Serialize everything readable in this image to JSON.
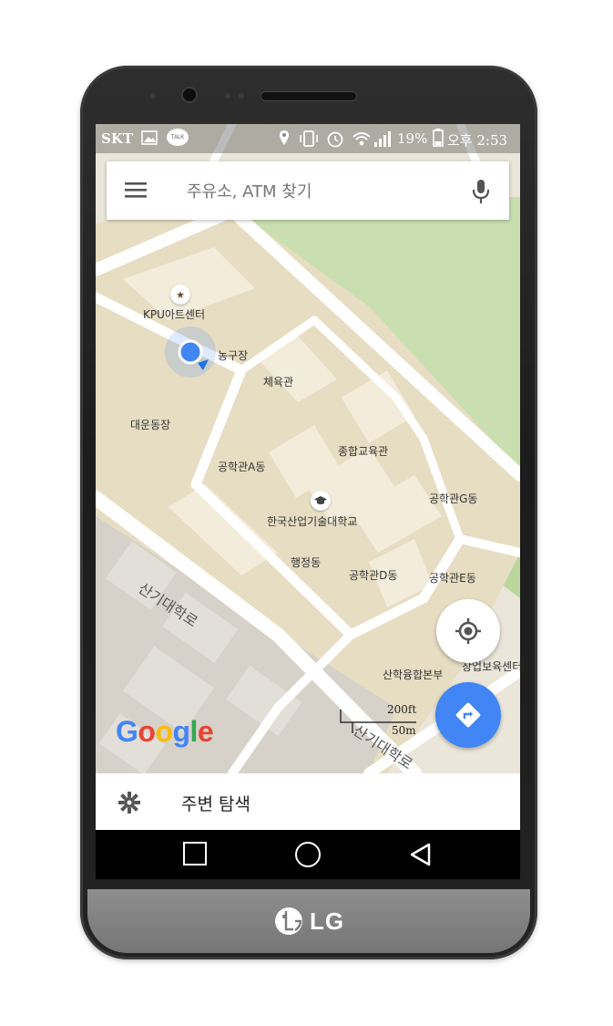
{
  "status_bar": {
    "carrier": "SKT",
    "battery": "19%",
    "time": "오후 2:53",
    "talk_badge": "TALK"
  },
  "search": {
    "placeholder": "주유소, ATM 찾기"
  },
  "map": {
    "pois": {
      "art_center": "KPU아트센터",
      "basketball": "농구장",
      "gym": "체육관",
      "stadium": "대운동장",
      "complex_edu": "종합교육관",
      "eng_a": "공학관A동",
      "university": "한국산업기술대학교",
      "eng_g": "공학관G동",
      "admin": "행정동",
      "eng_d": "공학관D동",
      "eng_e": "공학관E동",
      "industry_hq": "산학융합본부",
      "startup_center": "창업보육센터"
    },
    "roads": {
      "sangi_road_1": "산기대학로",
      "sangi_road_2": "산기대학로"
    },
    "scale": {
      "imperial": "200ft",
      "metric": "50m"
    },
    "logo": "Google"
  },
  "bottom_sheet": {
    "label": "주변 탐색"
  },
  "brand": {
    "logo": "LG"
  },
  "colors": {
    "accent_blue": "#4285f4",
    "campus_fill": "#e6dcc2",
    "park_green": "#c8dfae",
    "road_white": "#ffffff"
  }
}
